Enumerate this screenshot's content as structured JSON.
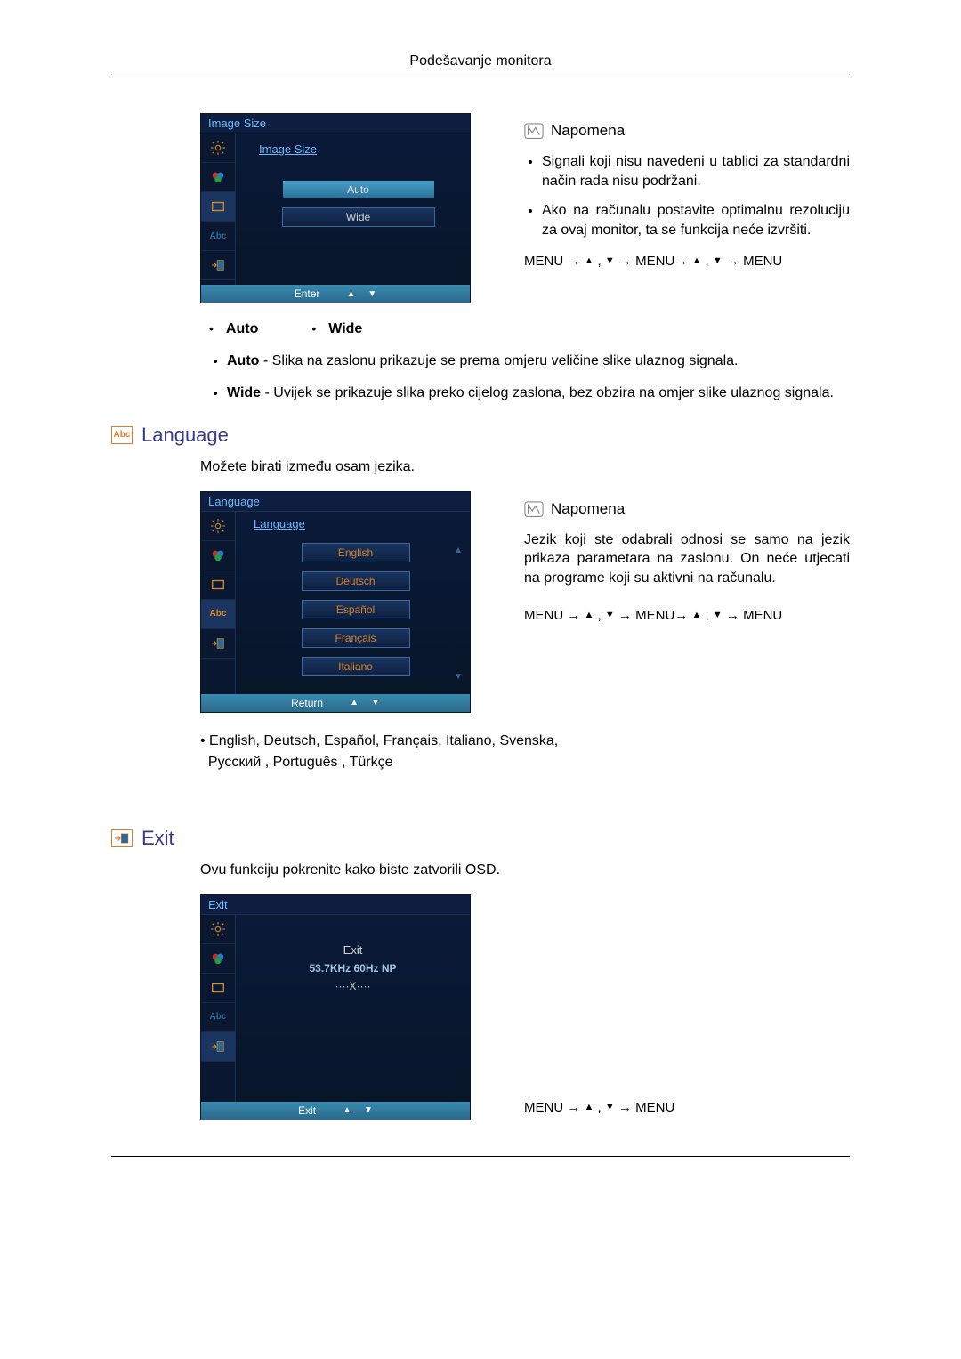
{
  "header": "Podešavanje monitora",
  "image_size": {
    "osd": {
      "title": "Image Size",
      "group_label": "Image Size",
      "options": [
        "Auto",
        "Wide"
      ],
      "footer_label": "Enter"
    },
    "note_title": "Napomena",
    "notes": [
      "Signali koji nisu navedeni u tablici za standardni način rada nisu podržani.",
      "Ako na računalu postavite optimalnu rezoluciju za ovaj monitor, ta se funkcija neće izvršiti."
    ],
    "nav": "MENU → ▲ , ▼ → MENU→ ▲ , ▼ → MENU",
    "opt_auto": "Auto",
    "opt_wide": "Wide",
    "desc_auto_b": "Auto",
    "desc_auto": " - Slika na zaslonu prikazuje se prema omjeru veličine slike ulaznog signala.",
    "desc_wide_b": "Wide",
    "desc_wide": " - Uvijek se prikazuje slika preko cijelog zaslona, bez obzira na omjer slike ulaznog signala."
  },
  "language": {
    "heading": "Language",
    "intro": "Možete birati između osam jezika.",
    "osd": {
      "title": "Language",
      "group_label": "Language",
      "options": [
        "English",
        "Deutsch",
        "Español",
        "Français",
        "Italiano"
      ],
      "footer_label": "Return"
    },
    "note_title": "Napomena",
    "note_body": "Jezik koji ste odabrali odnosi se samo na jezik prikaza parametara na zaslonu. On neće utjecati na programe koji su aktivni na računalu.",
    "nav": "MENU → ▲ , ▼ → MENU→ ▲ , ▼ → MENU",
    "lang_list": "• English, Deutsch, Español, Français,  Italiano, Svenska, Русский , Português , Türkçe"
  },
  "exit": {
    "heading": "Exit",
    "intro": "Ovu funkciju pokrenite kako biste zatvorili OSD.",
    "osd": {
      "title": "Exit",
      "line1": "Exit",
      "line2": "53.7KHz 60Hz NP",
      "line3": "····X····",
      "footer_label": "Exit"
    },
    "nav": "MENU → ▲ , ▼ → MENU"
  },
  "icons": {
    "note": "note-icon",
    "abc": "Abc"
  }
}
